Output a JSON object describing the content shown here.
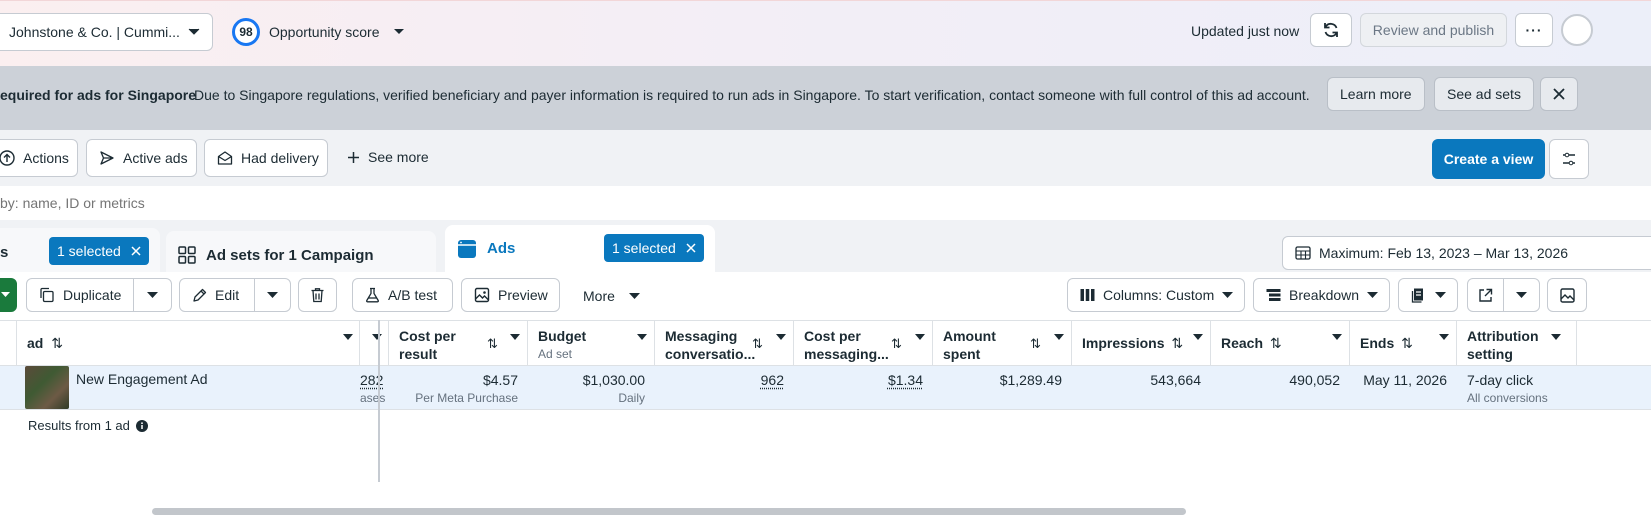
{
  "topbar": {
    "account_name": "Johnstone & Co. | Cummi...",
    "opportunity_score": "98",
    "opportunity_label": "Opportunity score",
    "updated_text": "Updated just now",
    "review_publish_label": "Review and publish"
  },
  "banner": {
    "title": "equired for ads for Singapore",
    "message": "Due to Singapore regulations, verified beneficiary and payer information is required to run ads in Singapore. To start verification, contact someone with full control of this ad account.",
    "learn_more_label": "Learn more",
    "see_ad_sets_label": "See ad sets"
  },
  "filters": {
    "actions_label": "Actions",
    "active_ads_label": "Active ads",
    "had_delivery_label": "Had delivery",
    "see_more_label": "See more",
    "create_view_label": "Create a view"
  },
  "search": {
    "placeholder": "by: name, ID or metrics"
  },
  "tabs": {
    "campaigns_partial": "s",
    "campaigns_selected": "1 selected",
    "adsets_label": "Ad sets for 1 Campaign",
    "ads_label": "Ads",
    "ads_selected": "1 selected",
    "date_range": "Maximum: Feb 13, 2023 – Mar 13, 2026"
  },
  "toolbar": {
    "duplicate_label": "Duplicate",
    "edit_label": "Edit",
    "ab_test_label": "A/B test",
    "preview_label": "Preview",
    "more_label": "More",
    "columns_label": "Columns: Custom",
    "breakdown_label": "Breakdown"
  },
  "table": {
    "headers": {
      "ad": "ad",
      "cost_per_result": "Cost per result",
      "budget": "Budget",
      "budget_sub": "Ad set",
      "messaging_conversations": "Messaging conversatio...",
      "cost_per_messaging": "Cost per messaging...",
      "amount_spent": "Amount spent",
      "impressions": "Impressions",
      "reach": "Reach",
      "ends": "Ends",
      "attribution": "Attribution setting"
    },
    "row": {
      "ad_name": "New Engagement Ad",
      "results_partial": "282",
      "results_partial_sub": "ases",
      "cost_per_result": "$4.57",
      "cost_per_result_sub": "Per Meta Purchase",
      "budget": "$1,030.00",
      "budget_sub": "Daily",
      "messaging_conversations": "962",
      "cost_per_messaging": "$1.34",
      "amount_spent": "$1,289.49",
      "impressions": "543,664",
      "reach": "490,052",
      "ends": "May 11, 2026",
      "attribution": "7-day click",
      "attribution_sub": "All conversions"
    },
    "results_summary": "Results from 1 ad"
  },
  "colors": {
    "accent": "#0a78be",
    "row_selected": "#e9f2fc",
    "banner": "#ccd1d8"
  }
}
